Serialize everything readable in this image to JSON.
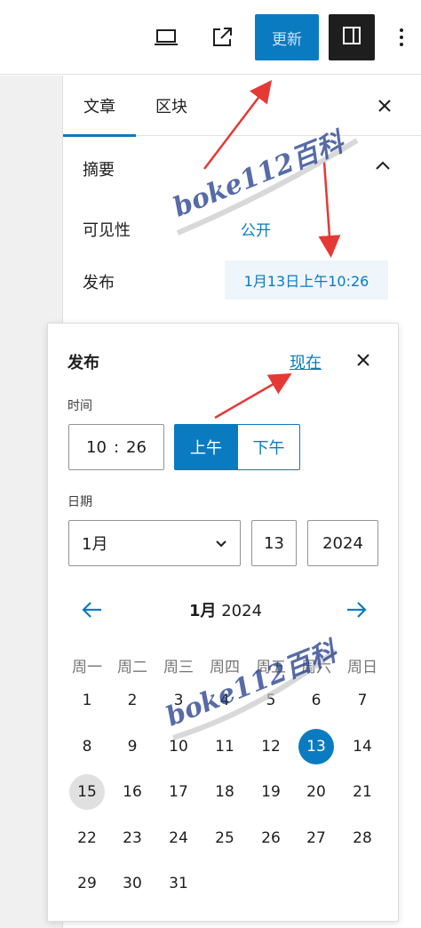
{
  "topbar": {
    "update_label": "更新",
    "icons": [
      "laptop-icon",
      "external-link-icon",
      "sidebar-toggle-icon",
      "more-vertical-icon"
    ]
  },
  "sidebar": {
    "tabs": [
      {
        "label": "文章"
      },
      {
        "label": "区块"
      }
    ],
    "summary_title": "摘要",
    "visibility_label": "可见性",
    "visibility_value": "公开",
    "publish_label": "发布",
    "publish_value": "1月13日上午10:26"
  },
  "popover": {
    "title": "发布",
    "now_label": "现在",
    "time_label": "时间",
    "hour": "10",
    "separator": ":",
    "minute": "26",
    "am_label": "上午",
    "pm_label": "下午",
    "date_label": "日期",
    "month_value": "1月",
    "day_value": "13",
    "year_value": "2024",
    "calendar": {
      "month_title": "1月",
      "year_title": "2024",
      "weekdays": [
        "周一",
        "周二",
        "周三",
        "周四",
        "周五",
        "周六",
        "周日"
      ],
      "days": [
        "1",
        "2",
        "3",
        "4",
        "5",
        "6",
        "7",
        "8",
        "9",
        "10",
        "11",
        "12",
        "13",
        "14",
        "15",
        "16",
        "17",
        "18",
        "19",
        "20",
        "21",
        "22",
        "23",
        "24",
        "25",
        "26",
        "27",
        "28",
        "29",
        "30",
        "31"
      ],
      "selected_day": 13,
      "today": 15
    }
  },
  "watermark": "boke112百科",
  "colors": {
    "accent": "#0a7bc0",
    "arrow": "#e53935",
    "selected_bg": "#0a7bc0",
    "today_bg": "#e0e0e0"
  }
}
